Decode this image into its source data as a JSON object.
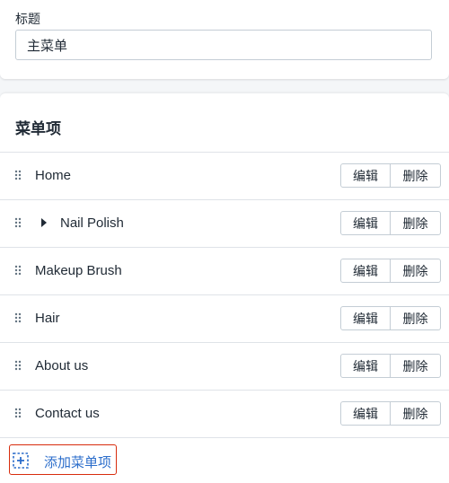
{
  "title_field": {
    "label": "标题",
    "value": "主菜单"
  },
  "menu_section": {
    "heading": "菜单项",
    "edit_label": "编辑",
    "delete_label": "删除",
    "items": [
      {
        "label": "Home",
        "has_children": false
      },
      {
        "label": "Nail Polish",
        "has_children": true
      },
      {
        "label": "Makeup Brush",
        "has_children": false
      },
      {
        "label": "Hair",
        "has_children": false
      },
      {
        "label": "About us",
        "has_children": false
      },
      {
        "label": "Contact us",
        "has_children": false
      }
    ],
    "add_item_label": "添加菜单项"
  },
  "colors": {
    "link": "#2c6ecb",
    "focus_border": "#d82c0d",
    "border": "#c4cdd5"
  }
}
